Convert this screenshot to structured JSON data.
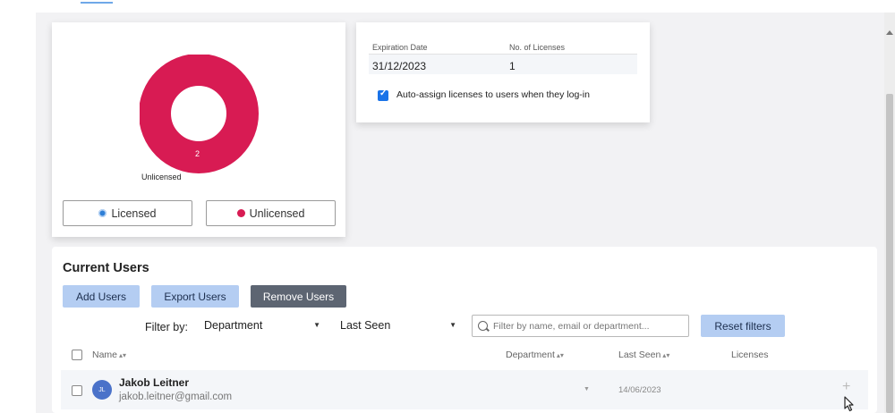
{
  "chart": {
    "slice_label": "Unlicensed",
    "slice_count": "2",
    "colors": {
      "licensed": "#2e7fd6",
      "unlicensed": "#d81b53"
    },
    "legend": {
      "licensed": "Licensed",
      "unlicensed": "Unlicensed"
    }
  },
  "chart_data": {
    "type": "pie",
    "categories": [
      "Licensed",
      "Unlicensed"
    ],
    "values": [
      0,
      2
    ],
    "legend": "bottom"
  },
  "license_info": {
    "headers": {
      "expiration": "Expiration Date",
      "licenses": "No. of Licenses"
    },
    "expiration_value": "31/12/2023",
    "licenses_value": "1",
    "auto_assign_label": "Auto-assign licenses to users when they log-in",
    "auto_assign_checked": true
  },
  "users": {
    "title": "Current Users",
    "buttons": {
      "add": "Add Users",
      "export": "Export Users",
      "remove": "Remove Users"
    },
    "filter_label": "Filter by:",
    "department_select": "Department",
    "last_seen_select": "Last Seen",
    "search_placeholder": "Filter by name, email or department...",
    "reset_label": "Reset filters",
    "columns": {
      "name": "Name",
      "department": "Department",
      "last_seen": "Last Seen",
      "licenses": "Licenses"
    },
    "rows": [
      {
        "initials": "JL",
        "name": "Jakob Leitner",
        "email": "jakob.leitner@gmail.com",
        "last_seen": "14/06/2023"
      }
    ]
  },
  "icons": {
    "sort": "sort-icon",
    "chevron": "chevron-down-icon",
    "search": "search-icon",
    "plus": "plus-icon",
    "cursor": "mouse-cursor-icon"
  }
}
